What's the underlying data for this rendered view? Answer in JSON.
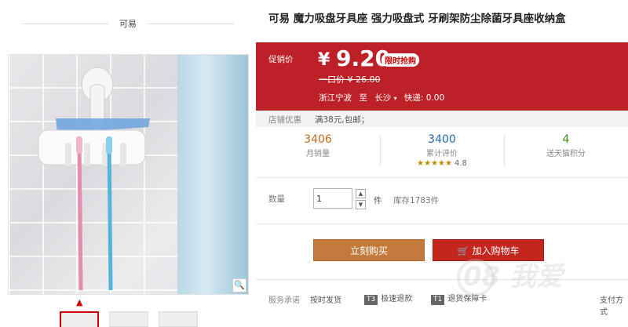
{
  "store": {
    "name": "可易"
  },
  "product": {
    "title": "可易 魔力吸盘牙具座 强力吸盘式 牙刷架防尘除菌牙具座收纳盒"
  },
  "price": {
    "promo_label": "促销价",
    "currency": "¥",
    "value": "9.20",
    "tag": "限时抢购",
    "original": "一口价 ¥ 26.00",
    "shipping_from": "浙江宁波",
    "shipping_to_word": "至",
    "shipping_to": "长沙",
    "shipping_fee": "快递: 0.00"
  },
  "promo": {
    "label": "店铺优惠",
    "value": "满38元,包邮；"
  },
  "stats": [
    {
      "number": "3406",
      "desc": "月销量",
      "color": "#c76a1c"
    },
    {
      "number": "3400",
      "desc": "累计评价",
      "color": "#2a6bb0",
      "stars": "★★★★★",
      "rating": "4.8"
    },
    {
      "number": "4",
      "desc": "送天猫积分",
      "color": "#3a8a1c"
    }
  ],
  "quantity": {
    "label": "数量",
    "value": "1",
    "unit": "件",
    "stock": "库存1783件"
  },
  "buttons": {
    "buy_now": "立刻购买",
    "add_cart": "加入购物车"
  },
  "service": {
    "label": "服务承诺",
    "items": [
      {
        "badge": "",
        "text": "按时发货"
      },
      {
        "badge": "T3",
        "text": "极速退款"
      },
      {
        "badge": "T1",
        "text": "退货保障卡"
      },
      {
        "badge": "",
        "text": "支付方式"
      }
    ]
  },
  "watermark": "08 我爱",
  "colors": {
    "accent": "#bd2026",
    "buy": "#c47a3c",
    "cart": "#c4251d"
  }
}
